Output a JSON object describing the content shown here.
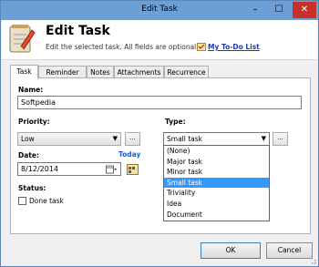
{
  "window": {
    "title": "Edit Task",
    "minimize": "–",
    "maximize": "☐",
    "close": "✕"
  },
  "header": {
    "title": "Edit Task",
    "description": "Edit the selected task. All fields are optional.",
    "link": "My To-Do List"
  },
  "tabs": [
    "Task",
    "Reminder",
    "Notes",
    "Attachments",
    "Recurrence"
  ],
  "form": {
    "name_label": "Name:",
    "name_value": "Softpedia",
    "priority_label": "Priority:",
    "priority_value": "Low",
    "type_label": "Type:",
    "type_value": "Small task",
    "date_label": "Date:",
    "today_link": "Today",
    "date_value": "8/12/2014",
    "status_label": "Status:",
    "done_label": "Done task",
    "dots": "..."
  },
  "type_options": [
    "(None)",
    "Major task",
    "Minor task",
    "Small task",
    "Triviality",
    "Idea",
    "Document"
  ],
  "type_selected_index": 3,
  "buttons": {
    "ok": "OK",
    "cancel": "Cancel"
  }
}
